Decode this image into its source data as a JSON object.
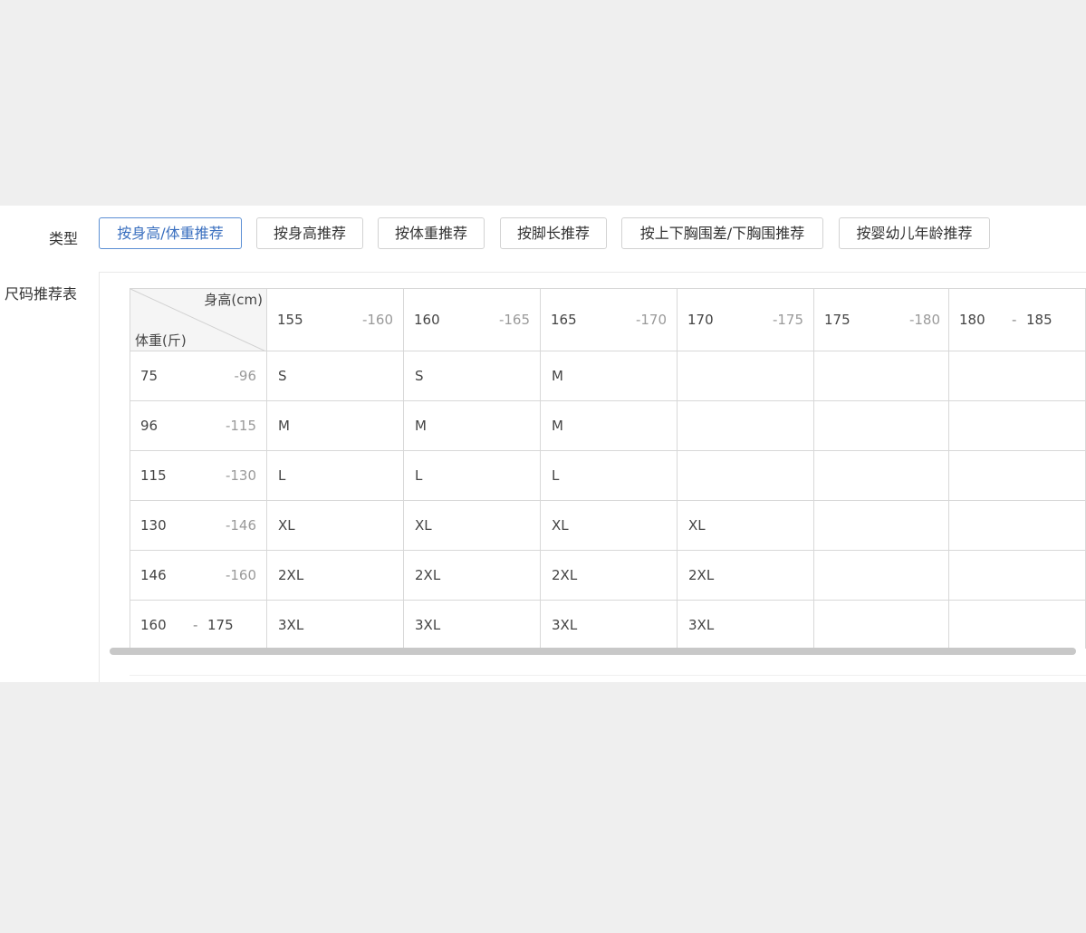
{
  "type_row": {
    "label": "类型",
    "buttons": [
      {
        "label": "按身高/体重推荐",
        "active": true
      },
      {
        "label": "按身高推荐",
        "active": false
      },
      {
        "label": "按体重推荐",
        "active": false
      },
      {
        "label": "按脚长推荐",
        "active": false
      },
      {
        "label": "按上下胸围差/下胸围推荐",
        "active": false
      },
      {
        "label": "按婴幼儿年龄推荐",
        "active": false
      }
    ]
  },
  "size_table": {
    "label": "尺码推荐表",
    "corner": {
      "height_label": "身高(cm)",
      "weight_label": "体重(斤)"
    },
    "height_ranges": [
      {
        "low": "155",
        "high": "-160"
      },
      {
        "low": "160",
        "high": "-165"
      },
      {
        "low": "165",
        "high": "-170"
      },
      {
        "low": "170",
        "high": "-175"
      },
      {
        "low": "175",
        "high": "-180"
      },
      {
        "low": "180",
        "sep": "-",
        "high": "185"
      }
    ],
    "rows": [
      {
        "weight_low": "75",
        "weight_high": "-96",
        "sizes": [
          "S",
          "S",
          "M",
          "",
          "",
          ""
        ]
      },
      {
        "weight_low": "96",
        "weight_high": "-115",
        "sizes": [
          "M",
          "M",
          "M",
          "",
          "",
          ""
        ]
      },
      {
        "weight_low": "115",
        "weight_high": "-130",
        "sizes": [
          "L",
          "L",
          "L",
          "",
          "",
          ""
        ]
      },
      {
        "weight_low": "130",
        "weight_high": "-146",
        "sizes": [
          "XL",
          "XL",
          "XL",
          "XL",
          "",
          ""
        ]
      },
      {
        "weight_low": "146",
        "weight_high": "-160",
        "sizes": [
          "2XL",
          "2XL",
          "2XL",
          "2XL",
          "",
          ""
        ]
      },
      {
        "weight_low": "160",
        "weight_sep": "-",
        "weight_high": "175",
        "sizes": [
          "3XL",
          "3XL",
          "3XL",
          "3XL",
          "",
          ""
        ]
      }
    ]
  }
}
